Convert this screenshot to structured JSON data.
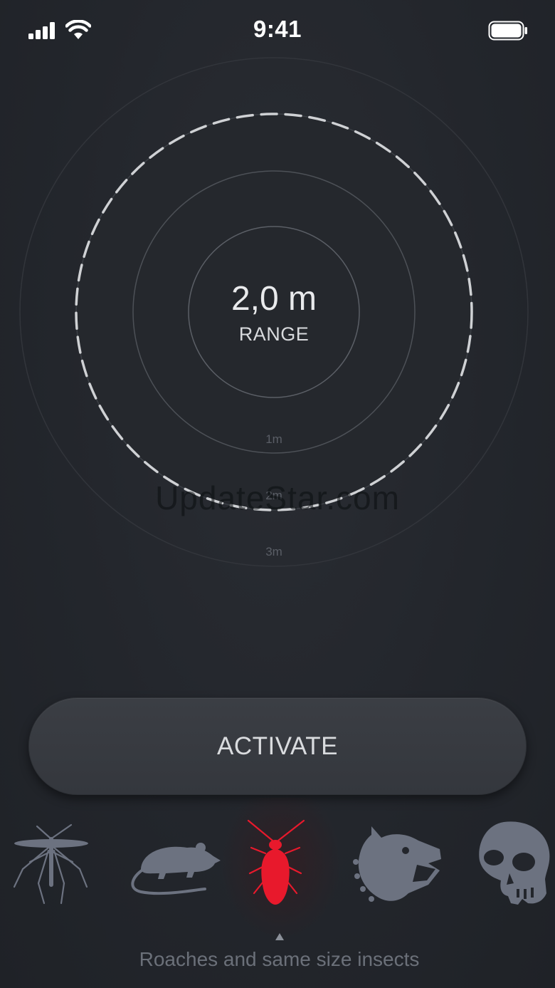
{
  "status_bar": {
    "time": "9:41",
    "signal_icon": "cellular-signal-icon",
    "wifi_icon": "wifi-icon",
    "battery_icon": "battery-icon"
  },
  "radar": {
    "range_value": "2,0 m",
    "range_label": "RANGE",
    "ring_labels": [
      "1m",
      "2m",
      "3m"
    ]
  },
  "watermark": "UpdateStar.com",
  "activate_label": "ACTIVATE",
  "pests": [
    {
      "name": "mosquito",
      "icon": "mosquito-icon",
      "selected": false
    },
    {
      "name": "rat",
      "icon": "rat-icon",
      "selected": false
    },
    {
      "name": "cockroach",
      "icon": "cockroach-icon",
      "selected": true
    },
    {
      "name": "dog",
      "icon": "dog-icon",
      "selected": false
    },
    {
      "name": "skull",
      "icon": "skull-icon",
      "selected": false
    }
  ],
  "selected_pest_caption": "Roaches and same size insects",
  "colors": {
    "background": "#23262c",
    "accent_selected": "#e8192c",
    "icon_inactive": "#6c7280"
  }
}
